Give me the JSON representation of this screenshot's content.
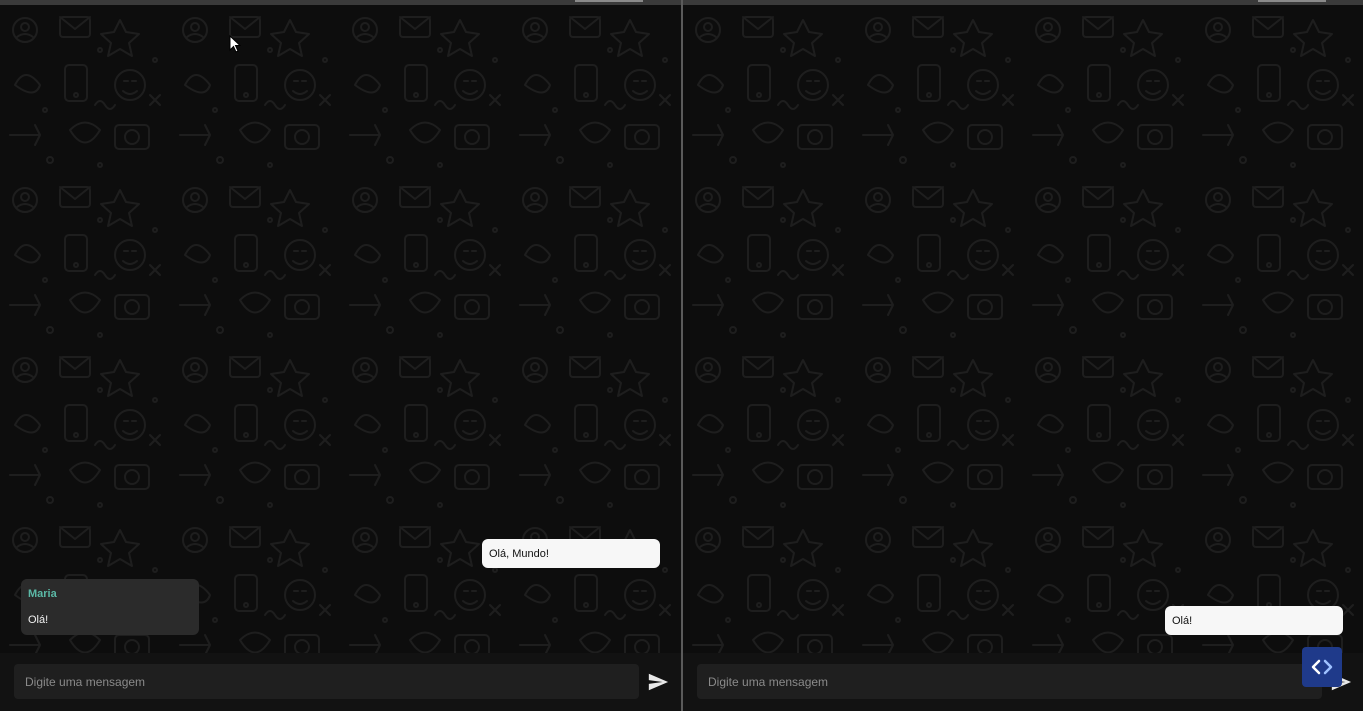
{
  "left_chat": {
    "outgoing_message": "Olá, Mundo!",
    "incoming_sender": "Maria",
    "incoming_message": "Olá!",
    "input_placeholder": "Digite uma mensagem",
    "send_icon": "send-icon"
  },
  "right_chat": {
    "outgoing_message": "Olá!",
    "input_placeholder": "Digite uma mensagem",
    "send_icon": "send-icon"
  },
  "colors": {
    "background": "#0d0d0d",
    "outgoing_bubble": "#f7f7f7",
    "incoming_bubble": "#2b2b2b",
    "sender_name": "#5bb8a6",
    "input_bar": "#121212",
    "input_field": "#1f1f1f",
    "widget": "#1f3a8a"
  }
}
